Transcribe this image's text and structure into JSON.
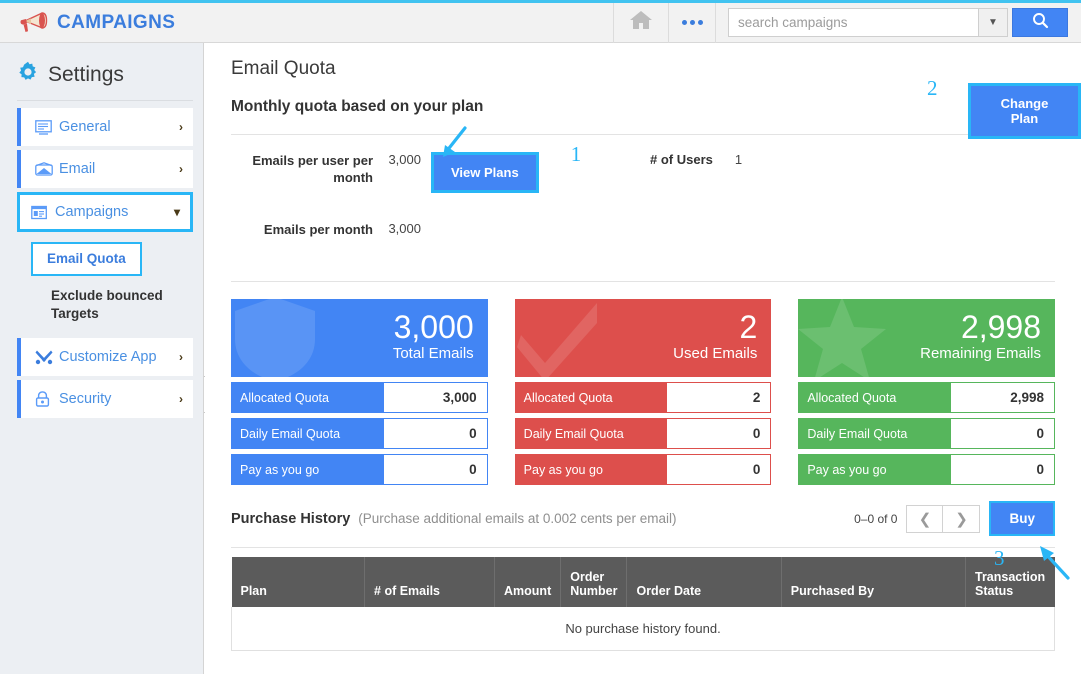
{
  "topbar": {
    "brand": "CAMPAIGNS",
    "home_icon": "home-icon",
    "more_icon": "more-dots-icon",
    "search_placeholder": "search campaigns",
    "search_value": "",
    "search_icon": "search-icon",
    "dropdown_icon": "chevron-down-icon"
  },
  "sidebar": {
    "heading": "Settings",
    "gear_icon": "gear-icon",
    "items": [
      {
        "label": "General",
        "icon": "monitor-icon",
        "chevron": "›"
      },
      {
        "label": "Email",
        "icon": "envelope-icon",
        "chevron": "›"
      },
      {
        "label": "Campaigns",
        "icon": "campaign-window-icon",
        "chevron": "⌄"
      },
      {
        "label": "Customize App",
        "icon": "tools-icon",
        "chevron": "›"
      },
      {
        "label": "Security",
        "icon": "lock-icon",
        "chevron": "›"
      }
    ],
    "sub_items": [
      {
        "label": "Email Quota"
      },
      {
        "label": "Exclude bounced Targets"
      }
    ],
    "collapse_icon": "chevron-left-icon"
  },
  "main": {
    "page_title": "Email Quota",
    "section_title": "Monthly quota based on your plan",
    "change_plan_label": "Change Plan",
    "rows": [
      {
        "label": "Emails per user per month",
        "value": "3,000"
      },
      {
        "label": "Emails per month",
        "value": "3,000"
      }
    ],
    "view_plans_label": "View Plans",
    "users_label": "# of Users",
    "users_value": "1"
  },
  "cards": [
    {
      "accent": "#4285f4",
      "number": "3,000",
      "caption": "Total Emails",
      "watermark": "shield-icon",
      "rows": [
        {
          "key": "Allocated Quota",
          "value": "3,000"
        },
        {
          "key": "Daily Email Quota",
          "value": "0"
        },
        {
          "key": "Pay as you go",
          "value": "0"
        }
      ]
    },
    {
      "accent": "#dd4f4c",
      "number": "2",
      "caption": "Used Emails",
      "watermark": "check-icon",
      "rows": [
        {
          "key": "Allocated Quota",
          "value": "2"
        },
        {
          "key": "Daily Email Quota",
          "value": "0"
        },
        {
          "key": "Pay as you go",
          "value": "0"
        }
      ]
    },
    {
      "accent": "#56b65c",
      "number": "2,998",
      "caption": "Remaining Emails",
      "watermark": "star-icon",
      "rows": [
        {
          "key": "Allocated Quota",
          "value": "2,998"
        },
        {
          "key": "Daily Email Quota",
          "value": "0"
        },
        {
          "key": "Pay as you go",
          "value": "0"
        }
      ]
    }
  ],
  "purchase_history": {
    "title": "Purchase History",
    "note": "(Purchase additional emails at 0.002 cents per email)",
    "count": "0–0 of 0",
    "prev_icon": "chevron-left-icon",
    "next_icon": "chevron-right-icon",
    "buy_label": "Buy",
    "columns": [
      "Plan",
      "# of Emails",
      "Amount",
      "Order Number",
      "Order Date",
      "Purchased By",
      "Transaction Status"
    ],
    "empty_message": "No purchase history found."
  },
  "annotations": [
    {
      "number": "1",
      "target": "view-plans-button"
    },
    {
      "number": "2",
      "target": "change-plan-button"
    },
    {
      "number": "3",
      "target": "buy-button"
    }
  ],
  "colors": {
    "accent_blue": "#4285f4",
    "highlight_cyan": "#29b6f6",
    "danger_red": "#dd4f4c",
    "success_green": "#56b65c",
    "table_header": "#5b5b5b"
  }
}
